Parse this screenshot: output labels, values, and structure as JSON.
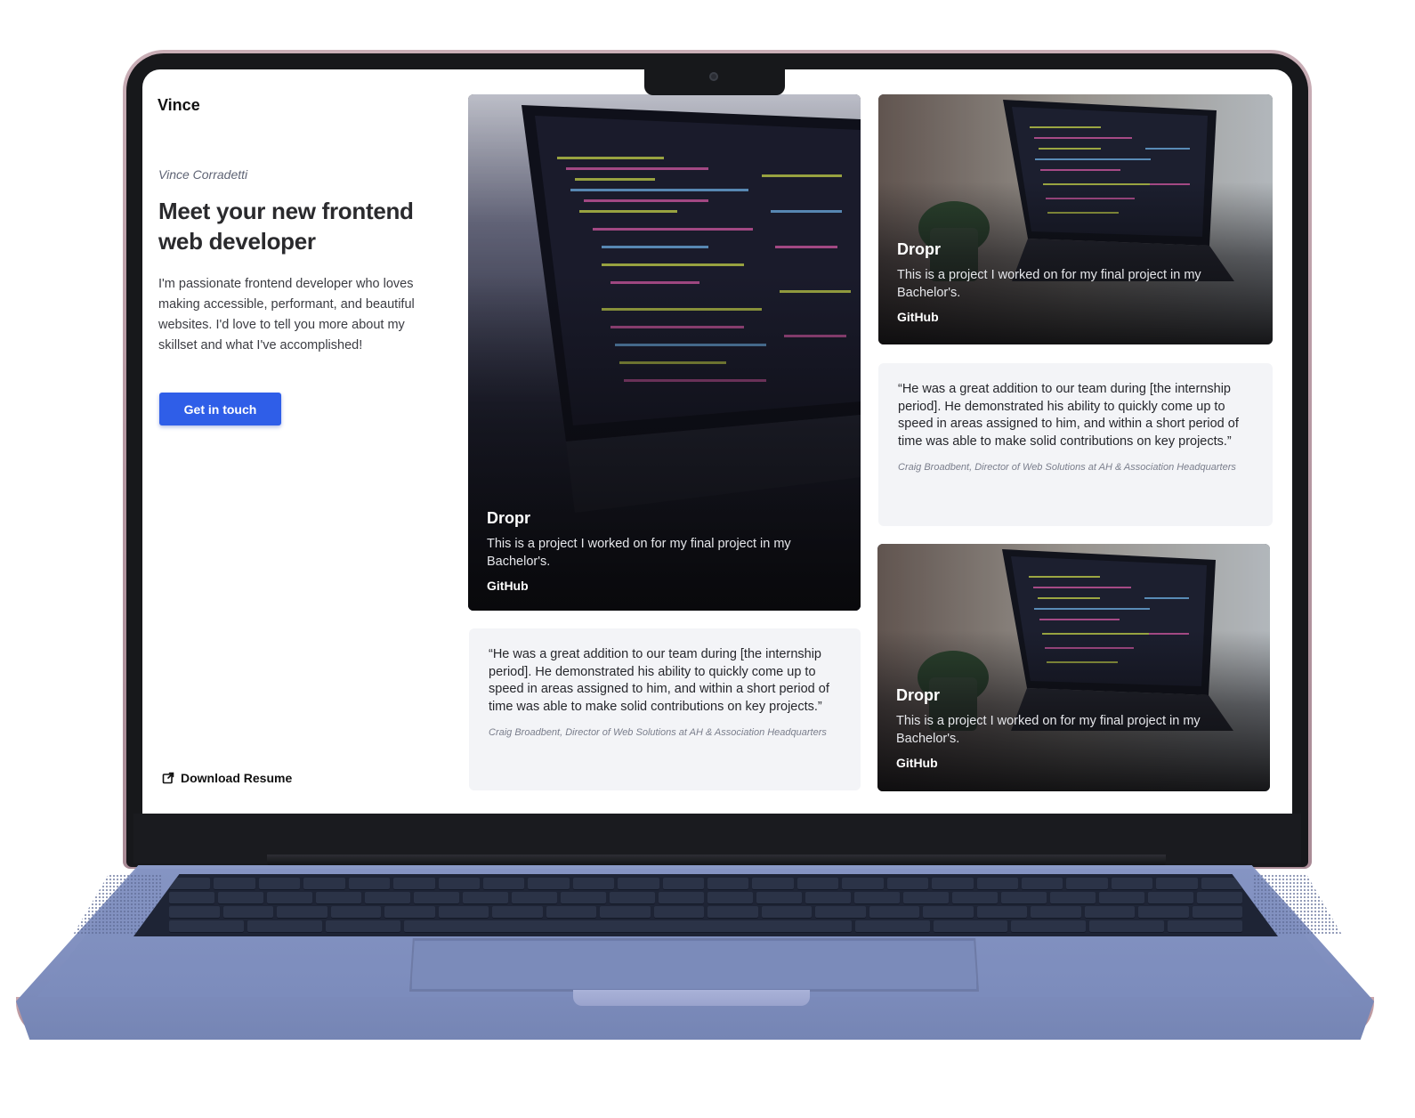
{
  "site": {
    "logo": "Vince",
    "name": "Vince Corradetti",
    "title": "Meet your new frontend web developer",
    "description": "I'm passionate frontend developer who loves making accessible, performant, and beautiful websites. I'd love to tell you more about my skillset and what I've accomplished!",
    "cta_label": "Get in touch",
    "resume_label": "Download Resume"
  },
  "projects": [
    {
      "title": "Dropr",
      "description": "This is a project I worked on for my final project in my Bachelor's.",
      "link": "GitHub"
    },
    {
      "title": "Dropr",
      "description": "This is a project I worked on for my final project in my Bachelor's.",
      "link": "GitHub"
    },
    {
      "title": "Dropr",
      "description": "This is a project I worked on for my final project in my Bachelor's.",
      "link": "GitHub"
    }
  ],
  "testimonials": [
    {
      "text": "“He was a great addition to our team during [the internship period]. He demonstrated his ability to quickly come up to speed in areas assigned to him, and within a short period of time was able to make solid contributions on key projects.”",
      "author": "Craig Broadbent, Director of Web Solutions at AH & Association Headquarters"
    },
    {
      "text": "“He was a great addition to our team during [the internship period]. He demonstrated his ability to quickly come up to speed in areas assigned to him, and within a short period of time was able to make solid contributions on key projects.”",
      "author": "Craig Broadbent, Director of Web Solutions at AH & Association Headquarters"
    }
  ],
  "colors": {
    "accent": "#2f5ee8",
    "laptop_lid": "#b89aa4",
    "laptop_base": "#7f8ebe",
    "card_bg": "#f3f4f7"
  },
  "icons": {
    "resume": "external-link-icon",
    "camera": "webcam-icon"
  }
}
